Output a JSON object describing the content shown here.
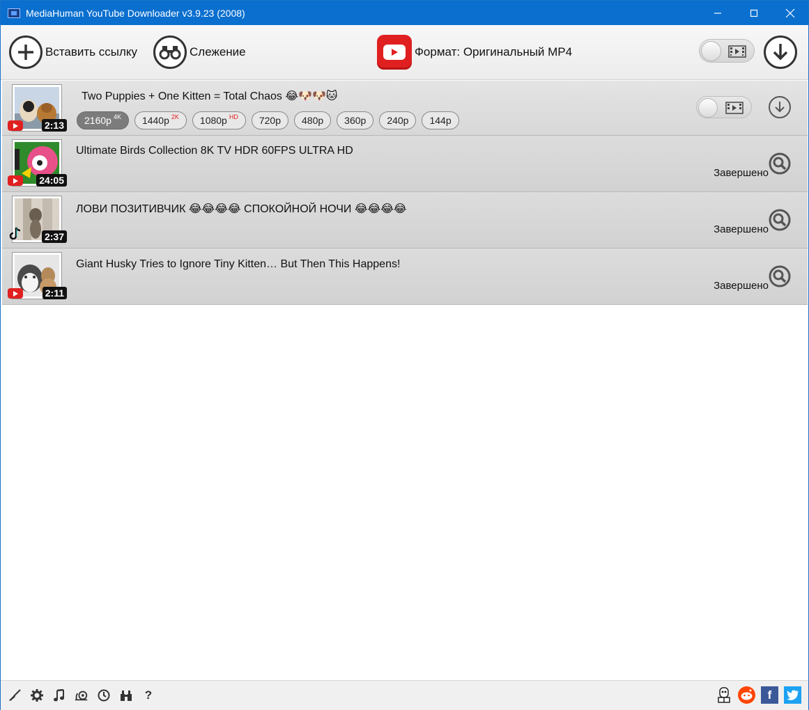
{
  "window": {
    "title": "MediaHuman YouTube Downloader v3.9.23 (2008)"
  },
  "toolbar": {
    "paste_label": "Вставить ссылку",
    "tracking_label": "Слежение",
    "format_label": "Формат: Оригинальный MP4"
  },
  "downloads": [
    {
      "title": "Two Puppies + One Kitten = Total Chaos 😂🐶🐶🐱",
      "duration": "2:13",
      "source": "youtube",
      "qualities": [
        {
          "label": "2160p",
          "badge": "4K",
          "selected": true
        },
        {
          "label": "1440p",
          "badge": "2K",
          "selected": false
        },
        {
          "label": "1080p",
          "badge": "HD",
          "selected": false
        },
        {
          "label": "720p",
          "badge": "",
          "selected": false
        },
        {
          "label": "480p",
          "badge": "",
          "selected": false
        },
        {
          "label": "360p",
          "badge": "",
          "selected": false
        },
        {
          "label": "240p",
          "badge": "",
          "selected": false
        },
        {
          "label": "144p",
          "badge": "",
          "selected": false
        }
      ]
    },
    {
      "title": "Ultimate Birds Collection 8K TV HDR 60FPS ULTRA HD",
      "duration": "24:05",
      "source": "youtube",
      "status": "Завершено"
    },
    {
      "title": "ЛОВИ ПОЗИТИВЧИК 😂😂😂😂 СПОКОЙНОЙ НОЧИ 😂😂😂😂",
      "duration": "2:37",
      "source": "tiktok",
      "status": "Завершено"
    },
    {
      "title": "Giant Husky Tries to Ignore Tiny Kitten… But Then This Happens!",
      "duration": "2:11",
      "source": "youtube",
      "status": "Завершено"
    }
  ],
  "colors": {
    "titlebar": "#0a6fcf",
    "youtube_red": "#e02020",
    "badge_red": "#e02020"
  }
}
